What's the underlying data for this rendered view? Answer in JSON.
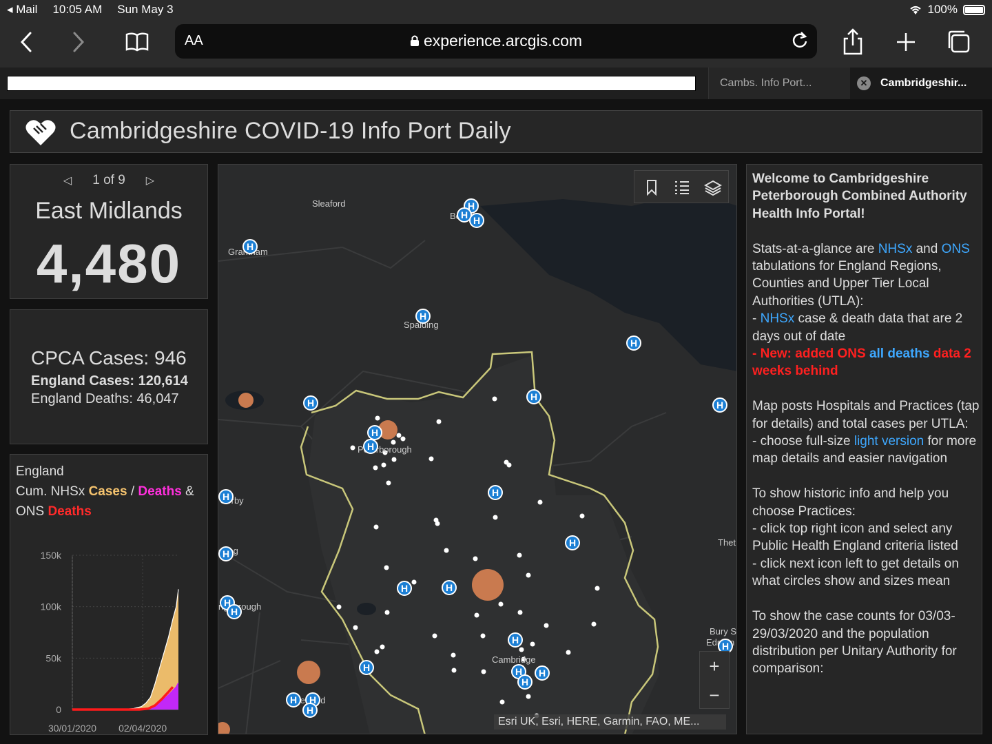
{
  "status": {
    "back_app": "Mail",
    "time": "10:05 AM",
    "date": "Sun May 3",
    "battery": "100%"
  },
  "browser": {
    "aa_label": "AA",
    "url": "experience.arcgis.com",
    "tabs": [
      {
        "label": "Cambs. Info Port..."
      },
      {
        "label": "Cambridgeshir..."
      }
    ]
  },
  "header": {
    "title": "Cambridgeshire COVID-19 Info Port Daily"
  },
  "indicator": {
    "pager": "1 of 9",
    "region": "East Midlands",
    "value": "4,480"
  },
  "summary": {
    "cpca": "CPCA Cases: 946",
    "england_cases": "England Cases: 120,614",
    "england_deaths": "England Deaths: 46,047"
  },
  "chart_panel": {
    "line1": "England",
    "line2_prefix": "Cum. NHSx ",
    "cases_word": "Cases",
    "slash": " / ",
    "deaths_word": "Deaths",
    "amp": " &",
    "ons_word": "ONS ",
    "ons_deaths_word": "Deaths"
  },
  "chart_data": {
    "type": "area",
    "x_tick_labels": [
      "30/01/2020",
      "02/04/2020"
    ],
    "y_tick_labels": [
      "150k",
      "100k",
      "50k",
      "0"
    ],
    "ylim": [
      0,
      150000
    ],
    "xlim_days": [
      0,
      95
    ],
    "series": [
      {
        "name": "Cases",
        "color": "#f5c36e",
        "x": [
          0,
          30,
          45,
          55,
          62,
          66,
          70,
          74,
          78,
          82,
          86,
          90,
          93,
          95
        ],
        "values": [
          0,
          0,
          100,
          1000,
          3000,
          6500,
          12000,
          25000,
          40000,
          55000,
          70000,
          88000,
          100000,
          117000
        ]
      },
      {
        "name": "Deaths",
        "color": "#c020ff",
        "x": [
          0,
          45,
          60,
          68,
          74,
          80,
          86,
          90,
          93,
          95
        ],
        "values": [
          0,
          0,
          200,
          1500,
          4000,
          8000,
          14000,
          18500,
          22000,
          26000
        ]
      },
      {
        "name": "ONS Deaths",
        "color": "#ff1a1a",
        "x": [
          0,
          60,
          68,
          74,
          80,
          86,
          90
        ],
        "values": [
          0,
          0,
          900,
          4000,
          10000,
          17000,
          22000
        ]
      }
    ]
  },
  "map": {
    "labels": [
      "Sleaford",
      "Boston",
      "Grantham",
      "Spalding",
      "Peterborough",
      "Corby",
      "ering",
      "ngborough",
      "Thet",
      "Bury S",
      "Edmun",
      "Cambridge",
      "Bedford"
    ],
    "attribution": "Esri UK, Esri, HERE, Garmin, FAO, ME...",
    "zoom_in": "+",
    "zoom_out": "−",
    "hospital_glyph": "H",
    "colors": {
      "boundary": "#c9c77a",
      "water": "#1b2026",
      "land": "#2a2b2c",
      "cases_circle": "#c97a4f",
      "hospital": "#1c7fd4"
    }
  },
  "info": {
    "welcome": "Welcome to Cambridgeshire Peterborough Combined Authority Health Info Portal!",
    "p2_a": "Stats-at-a-glance are ",
    "p2_nhsx": "NHSx",
    "p2_and": " and ",
    "p2_ons": "ONS",
    "p2_b": " tabulations for England Regions, Counties and Upper Tier Local  Authorities (UTLA):",
    "p2_c_dash": "- ",
    "p2_c_nhsx": "NHSx",
    "p2_c": " case & death  data that are 2 days out of date",
    "p2_d_dash": "- ",
    "p2_d_new": "New: added ONS",
    "p2_d_all": " all deaths",
    "p2_d_end": " data 2 weeks behind",
    "p3_a": "Map posts Hospitals and Practices (tap for details) and total cases per UTLA:",
    "p3_b": "- choose full-size ",
    "p3_link": "light version",
    "p3_c": " for more map details and easier navigation",
    "p4_a": "To show historic info and help you choose Practices:",
    "p4_b": "- click top right icon and select any Public Health England criteria listed",
    "p4_c": "- click next icon left to get details on what circles show and sizes mean",
    "p5_a": "To show the case counts for 03/03-29/03/2020 and the population distribution per Unitary Authority for comparison:"
  }
}
